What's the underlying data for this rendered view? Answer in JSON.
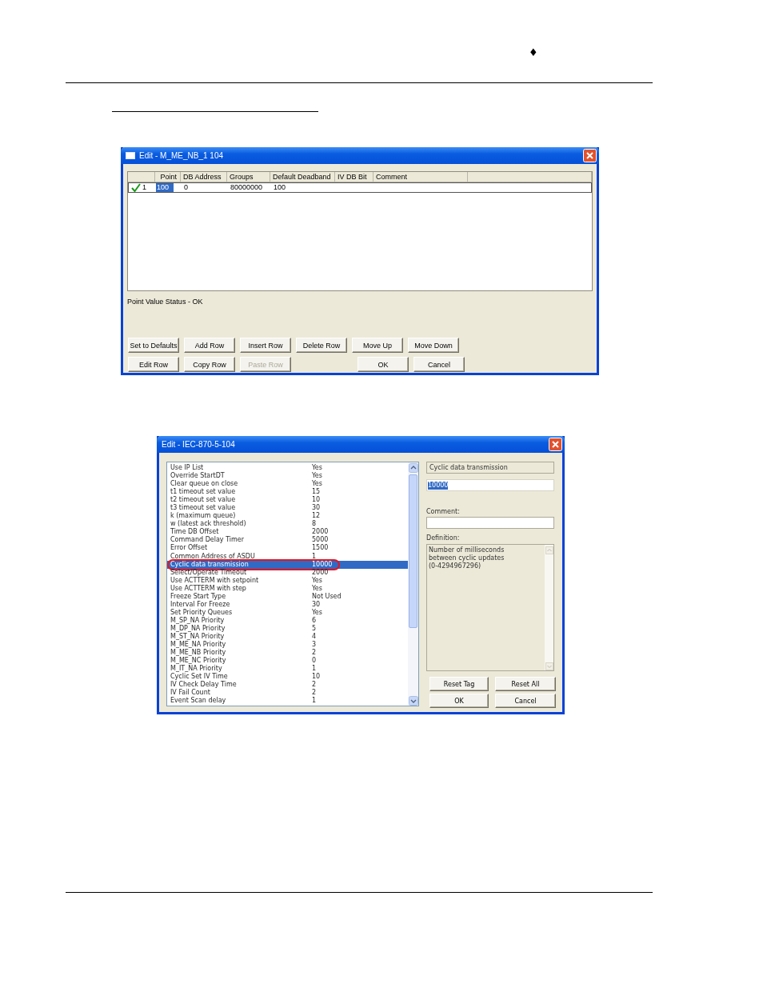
{
  "page_header": {
    "mark": "♦"
  },
  "point_editor": {
    "title": "Edit - M_ME_NB_1 104",
    "columns": [
      "Point",
      "DB Address",
      "Groups",
      "Default Deadband",
      "IV DB Bit",
      "Comment"
    ],
    "rows": [
      {
        "valid": true,
        "number": "1",
        "cells": [
          {
            "text": "100",
            "selected": true
          },
          {
            "text": "0",
            "selected": false
          },
          {
            "text": "80000000",
            "selected": false
          },
          {
            "text": "100",
            "selected": false
          }
        ]
      }
    ],
    "status": "Point Value Status - OK",
    "button_rows": [
      [
        {
          "label": "Set to Defaults",
          "disabled": false
        },
        {
          "label": "Add Row",
          "disabled": false
        },
        {
          "label": "Insert Row",
          "disabled": false
        },
        {
          "label": "Delete Row",
          "disabled": false
        },
        {
          "label": "Move Up",
          "disabled": false
        },
        {
          "label": "Move Down",
          "disabled": false
        }
      ],
      [
        {
          "label": "Edit Row",
          "disabled": false
        },
        {
          "label": "Copy Row",
          "disabled": false
        },
        {
          "label": "Paste Row",
          "disabled": true
        },
        {
          "kind": "spacer"
        },
        {
          "label": "OK",
          "disabled": false
        },
        {
          "label": "Cancel",
          "disabled": false
        }
      ]
    ]
  },
  "config_editor": {
    "title": "Edit - IEC-870-5-104",
    "items": [
      {
        "name": "Use IP List",
        "value": "Yes",
        "selected": false
      },
      {
        "name": "Override StartDT",
        "value": "Yes",
        "selected": false
      },
      {
        "name": "Clear queue on close",
        "value": "Yes",
        "selected": false
      },
      {
        "name": "t1 timeout set value",
        "value": "15",
        "selected": false
      },
      {
        "name": "t2 timeout set value",
        "value": "10",
        "selected": false
      },
      {
        "name": "t3 timeout set value",
        "value": "30",
        "selected": false
      },
      {
        "name": "k (maximum queue)",
        "value": "12",
        "selected": false
      },
      {
        "name": "w (latest ack threshold)",
        "value": "8",
        "selected": false
      },
      {
        "name": "Time DB Offset",
        "value": "2000",
        "selected": false
      },
      {
        "name": "Command Delay Timer",
        "value": "5000",
        "selected": false
      },
      {
        "name": "Error Offset",
        "value": "1500",
        "selected": false
      },
      {
        "name": "Common Address of ASDU",
        "value": "1",
        "selected": false
      },
      {
        "name": "Cyclic data transmission",
        "value": "10000",
        "selected": true,
        "circled": true
      },
      {
        "name": "Select/Operate Timeout",
        "value": "2000",
        "selected": false
      },
      {
        "name": "Use ACTTERM with setpoint",
        "value": "Yes",
        "selected": false
      },
      {
        "name": "Use ACTTERM with step",
        "value": "Yes",
        "selected": false
      },
      {
        "name": "Freeze Start Type",
        "value": "Not Used",
        "selected": false
      },
      {
        "name": "Interval For Freeze",
        "value": "30",
        "selected": false
      },
      {
        "name": "Set Priority Queues",
        "value": "Yes",
        "selected": false
      },
      {
        "name": "M_SP_NA Priority",
        "value": "6",
        "selected": false
      },
      {
        "name": "M_DP_NA Priority",
        "value": "5",
        "selected": false
      },
      {
        "name": "M_ST_NA Priority",
        "value": "4",
        "selected": false
      },
      {
        "name": "M_ME_NA Priority",
        "value": "3",
        "selected": false
      },
      {
        "name": "M_ME_NB Priority",
        "value": "2",
        "selected": false
      },
      {
        "name": "M_ME_NC Priority",
        "value": "0",
        "selected": false
      },
      {
        "name": "M_IT_NA Priority",
        "value": "1",
        "selected": false
      },
      {
        "name": "Cyclic Set IV Time",
        "value": "10",
        "selected": false
      },
      {
        "name": "IV Check Delay Time",
        "value": "2",
        "selected": false
      },
      {
        "name": "IV Fail Count",
        "value": "2",
        "selected": false
      },
      {
        "name": "Event Scan delay",
        "value": "1",
        "selected": false
      }
    ],
    "tag_name": "Cyclic data transmission",
    "value": "10000",
    "comment_label": "Comment:",
    "definition_label": "Definition:",
    "definition": "Number of milliseconds between cyclic updates (0-4294967296)",
    "buttons": [
      {
        "label": "Reset Tag"
      },
      {
        "label": "Reset All"
      },
      {
        "label": "OK"
      },
      {
        "label": "Cancel"
      }
    ]
  }
}
